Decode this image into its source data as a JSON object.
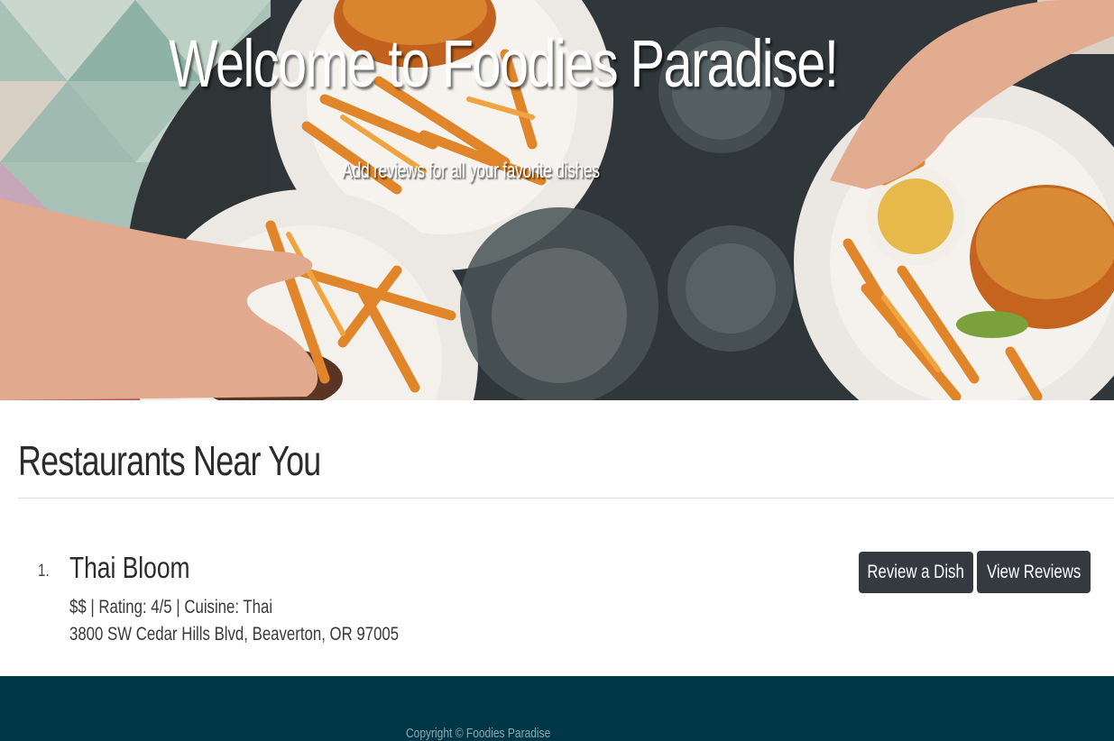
{
  "hero": {
    "title": "Welcome to Foodies Paradise!",
    "subtitle": "Add reviews for all your favorite dishes"
  },
  "restaurants_section": {
    "title": "Restaurants Near You",
    "items": [
      {
        "number": "1.",
        "name": "Thai Bloom",
        "meta": "$$ | Rating: 4/5 | Cuisine: Thai",
        "address": "3800 SW Cedar Hills Blvd, Beaverton, OR 97005",
        "review_button": "Review a Dish",
        "view_button": "View Reviews"
      }
    ]
  },
  "footer": {
    "copyright": "Copyright © Foodies Paradise"
  },
  "colors": {
    "button_bg": "#343a40",
    "footer_bg": "#003747",
    "hero_table": "#2e3436"
  }
}
